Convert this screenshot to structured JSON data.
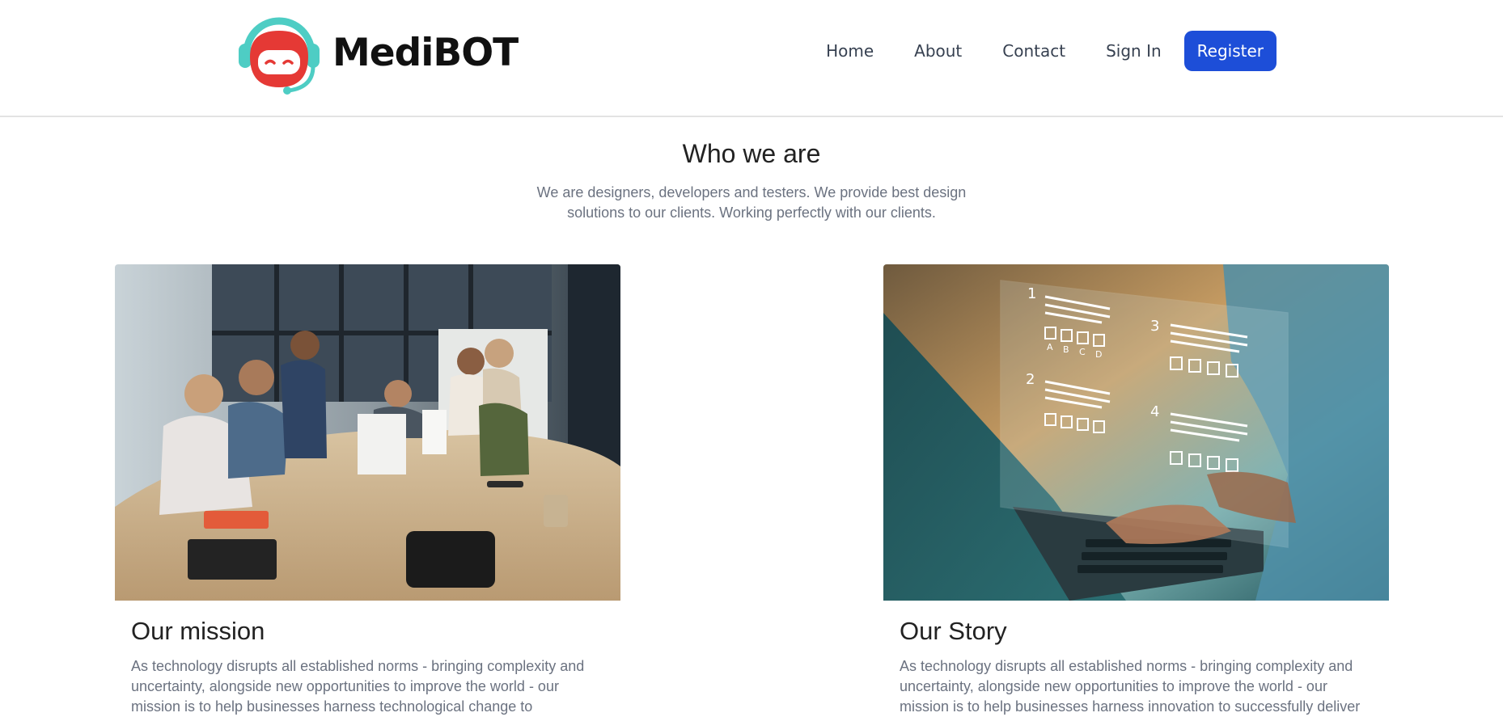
{
  "brand": {
    "name": "MediBOT",
    "logo_icon": "robot-headset-icon"
  },
  "nav": {
    "home": "Home",
    "about": "About",
    "contact": "Contact",
    "signin": "Sign In",
    "register": "Register"
  },
  "colors": {
    "accent": "#1d4ed8",
    "logo_red": "#e53935",
    "logo_teal": "#4ecdc4"
  },
  "about": {
    "heading": "Who we are",
    "intro": "We are designers, developers and testers. We provide best design solutions to our clients. Working perfectly with our clients."
  },
  "cards": [
    {
      "image": "team-meeting-photo",
      "title": "Our mission",
      "text": "As technology disrupts all established norms - bringing complexity and uncertainty, alongside new opportunities to improve the world - our mission is to help businesses harness technological change to"
    },
    {
      "image": "online-survey-laptop-photo",
      "title": "Our Story",
      "text": "As technology disrupts all established norms - bringing complexity and uncertainty, alongside new opportunities to improve the world - our mission is to help businesses harness innovation to successfully deliver",
      "overlay_numbers": [
        "1",
        "2",
        "3",
        "4"
      ],
      "overlay_options": [
        "A",
        "B",
        "C",
        "D"
      ]
    }
  ]
}
